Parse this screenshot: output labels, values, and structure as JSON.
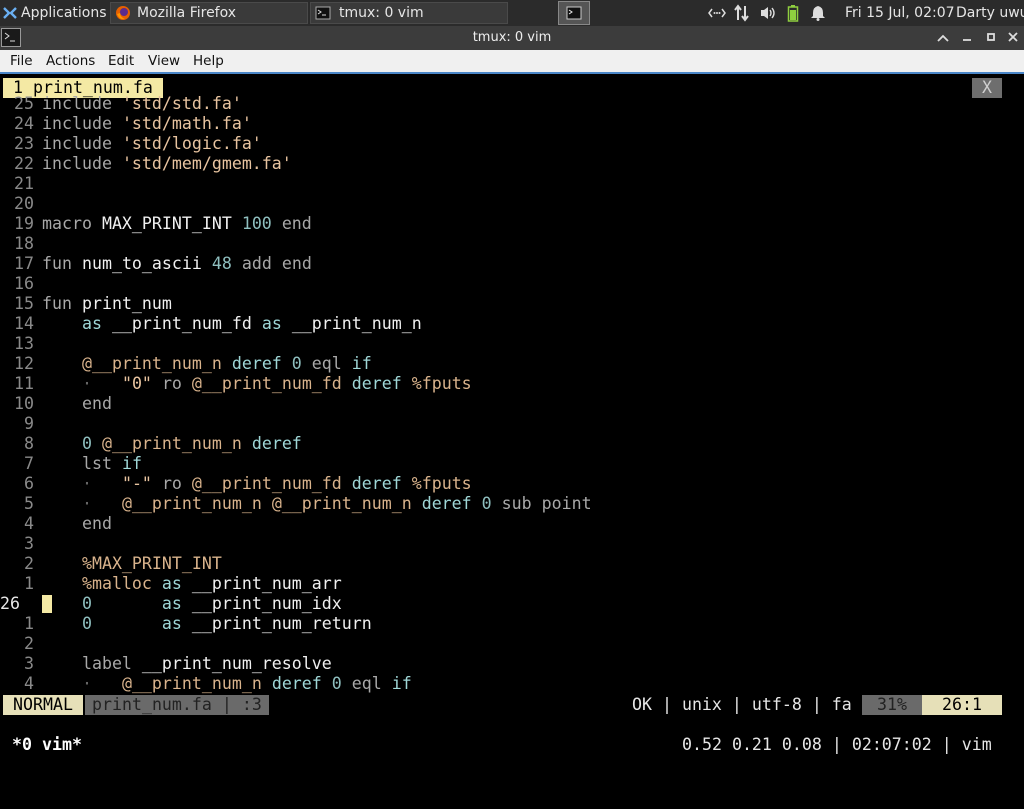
{
  "panel": {
    "applications": "Applications",
    "tasks": [
      {
        "label": "Mozilla Firefox",
        "icon": "firefox-icon"
      },
      {
        "label": "tmux: 0 vim",
        "icon": "terminal-icon"
      }
    ],
    "clock": "Fri 15 Jul, 02:07",
    "user": "Darty uwu",
    "tray_icons": [
      "network-icon",
      "transfer-icon",
      "volume-icon",
      "battery-icon",
      "bell-icon"
    ]
  },
  "window": {
    "title": "tmux: 0 vim",
    "menu": [
      "File",
      "Actions",
      "Edit",
      "View",
      "Help"
    ]
  },
  "vim": {
    "tab_label": "1 print_num.fa",
    "tab_close": "X",
    "lines": [
      {
        "num": "25",
        "text": "include 'std/std.fa'"
      },
      {
        "num": "24",
        "text": "include 'std/math.fa'"
      },
      {
        "num": "23",
        "text": "include 'std/logic.fa'"
      },
      {
        "num": "22",
        "text": "include 'std/mem/gmem.fa'"
      },
      {
        "num": "21",
        "text": ""
      },
      {
        "num": "20",
        "text": ""
      },
      {
        "num": "19",
        "text": "macro MAX_PRINT_INT 100 end"
      },
      {
        "num": "18",
        "text": ""
      },
      {
        "num": "17",
        "text": "fun num_to_ascii 48 add end"
      },
      {
        "num": "16",
        "text": ""
      },
      {
        "num": "15",
        "text": "fun print_num"
      },
      {
        "num": "14",
        "text": "    as __print_num_fd as __print_num_n"
      },
      {
        "num": "13",
        "text": ""
      },
      {
        "num": "12",
        "text": "    @__print_num_n deref 0 eql if"
      },
      {
        "num": "11",
        "text": "    ·   \"0\" ro @__print_num_fd deref %fputs"
      },
      {
        "num": "10",
        "text": "    end"
      },
      {
        "num": "9",
        "text": ""
      },
      {
        "num": "8",
        "text": "    0 @__print_num_n deref"
      },
      {
        "num": "7",
        "text": "    lst if"
      },
      {
        "num": "6",
        "text": "    ·   \"-\" ro @__print_num_fd deref %fputs"
      },
      {
        "num": "5",
        "text": "    ·   @__print_num_n @__print_num_n deref 0 sub point"
      },
      {
        "num": "4",
        "text": "    end"
      },
      {
        "num": "3",
        "text": ""
      },
      {
        "num": "2",
        "text": "    %MAX_PRINT_INT"
      },
      {
        "num": "1",
        "text": "    %malloc as __print_num_arr"
      },
      {
        "num": "26",
        "text": "    0       as __print_num_idx",
        "current": true
      },
      {
        "num": "1",
        "text": "    0       as __print_num_return"
      },
      {
        "num": "2",
        "text": ""
      },
      {
        "num": "3",
        "text": "    label __print_num_resolve"
      },
      {
        "num": "4",
        "text": "    ·   @__print_num_n deref 0 eql if"
      }
    ],
    "status": {
      "mode": "NORMAL",
      "file": "print_num.fa | :3",
      "right": "OK | unix | utf-8 | fa",
      "percent": "31%",
      "position": "26:1"
    }
  },
  "tmux": {
    "window": "*0 vim*",
    "right": "0.52 0.21 0.08 | 02:07:02 | vim"
  },
  "colors": {
    "accent_yellow": "#f4e9a4",
    "panel_bg": "#2b2b2b",
    "terminal_bg": "#000000"
  }
}
